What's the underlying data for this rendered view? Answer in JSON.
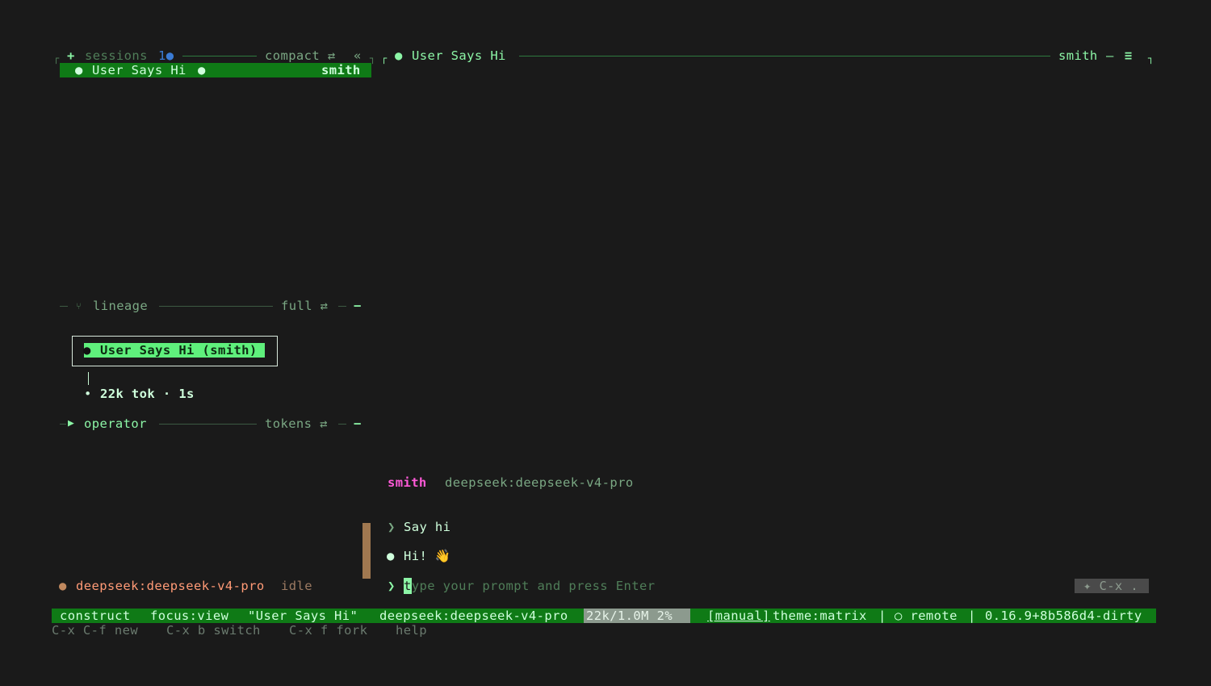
{
  "sidebar": {
    "plus_label": "+",
    "sessions_label": "sessions",
    "sessions_count": "1",
    "compact_label": "compact ⇄",
    "collapse_label": "«",
    "selected_session": {
      "title": "User Says Hi",
      "user": "smith"
    }
  },
  "header": {
    "session_title": "User Says Hi",
    "user": "smith",
    "dash": "—",
    "menu_glyph": "≡"
  },
  "lineage": {
    "label": "lineage",
    "mode": "full ⇄",
    "node_label": "User Says Hi (smith)",
    "node_stats": "22k tok · 1s"
  },
  "operator": {
    "label": "operator",
    "mode": "tokens ⇄"
  },
  "chat": {
    "author": "smith",
    "model": "deepseek:deepseek-v4-pro",
    "messages": [
      {
        "role": "user",
        "text": "Say hi"
      },
      {
        "role": "assistant",
        "text": "Hi! 👋"
      }
    ],
    "prompt_cursor_char": "t",
    "prompt_placeholder": "ype your prompt and press Enter",
    "key_hint": "✦ C-x ."
  },
  "model_status": {
    "model": "deepseek:deepseek-v4-pro",
    "state": "idle"
  },
  "status_bar": {
    "mode": "construct",
    "focus": "focus:view",
    "title": "\"User Says Hi\"",
    "model": "deepseek:deepseek-v4-pro",
    "tokens": "22k/1.0M 2%",
    "manual": "[manual]",
    "theme": "theme:matrix",
    "sep": "|",
    "remote": "○ remote",
    "version": "0.16.9+8b586d4-dirty"
  },
  "shortcuts": [
    {
      "label": "C-x C-f new"
    },
    {
      "label": "C-x b switch"
    },
    {
      "label": "C-x f fork"
    },
    {
      "label": "help"
    }
  ],
  "colors": {
    "background": "#1a1a1a",
    "accent_green": "#8cf5a6",
    "selection_green": "#0f7a16",
    "author_pink": "#ff5ad8",
    "idle_orange": "#e08a5a",
    "sessions_dot_blue": "#3a7bd5"
  }
}
